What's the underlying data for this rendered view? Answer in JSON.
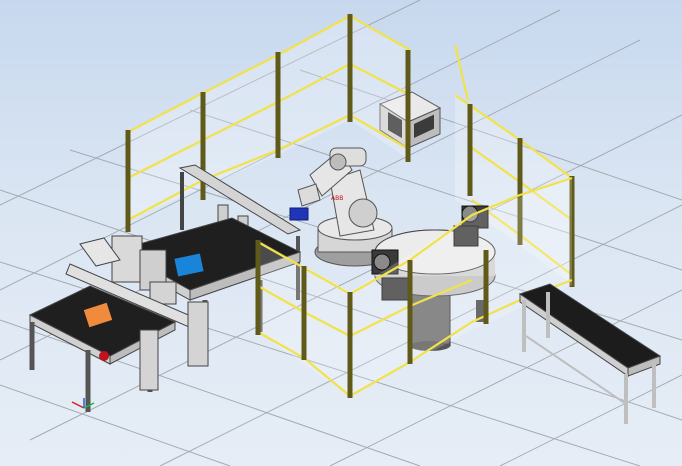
{
  "viewport": {
    "type": "3d-robot-station-view",
    "background_top": "#c7d8ee",
    "background_bottom": "#e6edf6"
  },
  "colors": {
    "fence_post": "#5f5a1a",
    "fence_rail": "#f2e24a",
    "robot_body": "#e6e6e6",
    "robot_joint": "#b9b9b9",
    "table_top": "#1f1f1f",
    "table_frame": "#d9d9d9",
    "part_orange": "#f08a3c",
    "part_blue": "#1a84d8",
    "conveyor_belt": "#1c1c1c",
    "grid_line": "#9aa0a8"
  },
  "scene_objects": [
    {
      "name": "safety-fence",
      "kind": "fence"
    },
    {
      "name": "industrial-robot",
      "kind": "robot",
      "logo": "ABB"
    },
    {
      "name": "robot-controller-cabinet",
      "kind": "cabinet"
    },
    {
      "name": "rotary-turntable",
      "kind": "turntable"
    },
    {
      "name": "assembly-workstation",
      "kind": "workbench"
    },
    {
      "name": "belt-conveyor",
      "kind": "conveyor"
    },
    {
      "name": "orange-workpiece",
      "kind": "part"
    },
    {
      "name": "blue-workpiece",
      "kind": "part"
    }
  ]
}
